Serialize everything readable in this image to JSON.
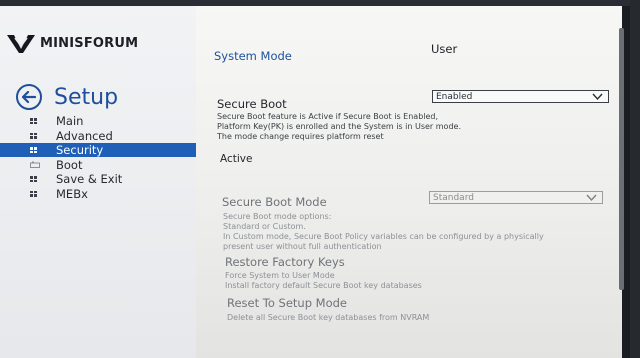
{
  "brand": {
    "name": "MINISFORUM"
  },
  "setup": {
    "title": "Setup"
  },
  "nav": {
    "items": [
      {
        "label": "Main"
      },
      {
        "label": "Advanced"
      },
      {
        "label": "Security"
      },
      {
        "label": "Boot"
      },
      {
        "label": "Save & Exit"
      },
      {
        "label": "MEBx"
      }
    ],
    "active": "Security"
  },
  "content": {
    "system_mode": {
      "label": "System Mode",
      "value": "User"
    },
    "secure_boot": {
      "label": "Secure Boot",
      "value": "Enabled",
      "help": [
        "Secure Boot feature is Active if Secure Boot is Enabled,",
        "Platform Key(PK) is enrolled and the System is in User mode.",
        "The mode change requires platform reset"
      ],
      "status": "Active"
    },
    "secure_boot_mode": {
      "label": "Secure Boot Mode",
      "value": "Standard",
      "help": [
        "Secure Boot mode options:",
        "Standard or Custom.",
        "In Custom mode, Secure Boot Policy variables can be configured by a physically",
        "present user without full authentication"
      ]
    },
    "restore_factory_keys": {
      "label": "Restore Factory Keys",
      "help": [
        "Force System to User Mode",
        "Install factory default Secure Boot key databases"
      ]
    },
    "reset_to_setup_mode": {
      "label": "Reset To Setup Mode",
      "help": [
        "Delete all Secure Boot key databases from NVRAM"
      ]
    }
  },
  "colors": {
    "accent": "#1f4f9c",
    "active_nav": "#1f5fb8",
    "panel": "#f4f4f2"
  }
}
